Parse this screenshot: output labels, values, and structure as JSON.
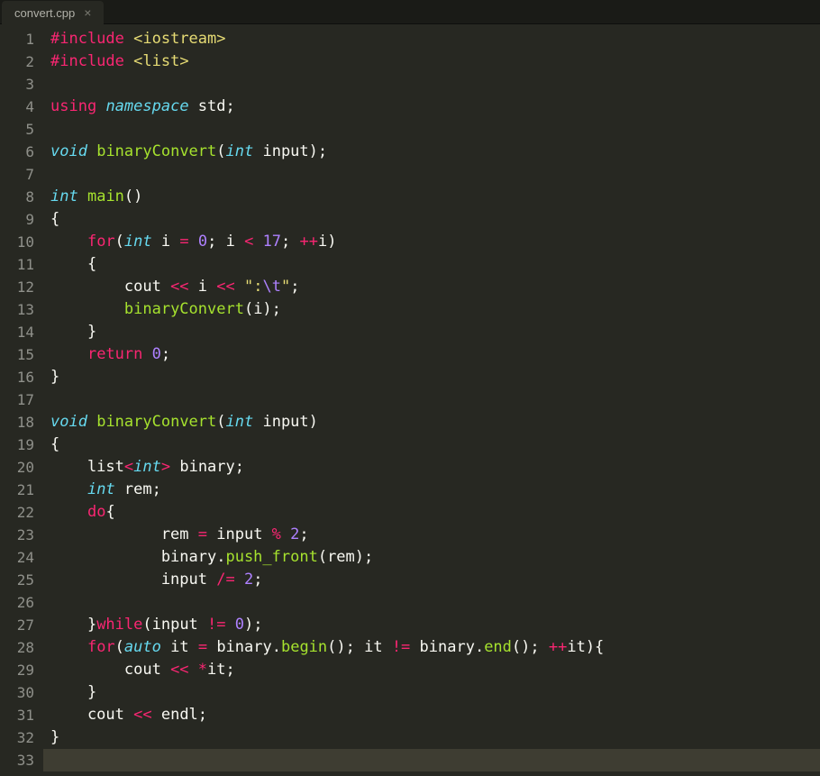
{
  "tab": {
    "title": "convert.cpp",
    "close_glyph": "×"
  },
  "gutter": {
    "start": 1,
    "end": 33
  },
  "colors": {
    "background": "#272822",
    "gutter_text": "#8f908a",
    "keyword_red": "#f92672",
    "type_blue": "#66d9ef",
    "func_green": "#a6e22e",
    "string_yellow": "#e6db74",
    "number_purple": "#ae81ff",
    "default_white": "#f8f8f2",
    "current_line_bg": "#3e3d32"
  },
  "current_line": 33,
  "code_lines": [
    [
      [
        "k-red",
        "#include"
      ],
      [
        "k-white",
        " "
      ],
      [
        "k-yellow",
        "<iostream>"
      ]
    ],
    [
      [
        "k-red",
        "#include"
      ],
      [
        "k-white",
        " "
      ],
      [
        "k-yellow",
        "<list>"
      ]
    ],
    [],
    [
      [
        "k-red",
        "using"
      ],
      [
        "k-white",
        " "
      ],
      [
        "k-blue",
        "namespace"
      ],
      [
        "k-white",
        " std;"
      ]
    ],
    [],
    [
      [
        "k-blue",
        "void"
      ],
      [
        "k-white",
        " "
      ],
      [
        "k-green",
        "binaryConvert"
      ],
      [
        "k-white",
        "("
      ],
      [
        "k-blue",
        "int"
      ],
      [
        "k-white",
        " input);"
      ]
    ],
    [],
    [
      [
        "k-blue",
        "int"
      ],
      [
        "k-white",
        " "
      ],
      [
        "k-green",
        "main"
      ],
      [
        "k-white",
        "()"
      ]
    ],
    [
      [
        "k-white",
        "{"
      ]
    ],
    [
      [
        "k-white",
        "    "
      ],
      [
        "k-red",
        "for"
      ],
      [
        "k-white",
        "("
      ],
      [
        "k-blue",
        "int"
      ],
      [
        "k-white",
        " i "
      ],
      [
        "k-red",
        "="
      ],
      [
        "k-white",
        " "
      ],
      [
        "k-purple",
        "0"
      ],
      [
        "k-white",
        "; i "
      ],
      [
        "k-red",
        "<"
      ],
      [
        "k-white",
        " "
      ],
      [
        "k-purple",
        "17"
      ],
      [
        "k-white",
        "; "
      ],
      [
        "k-red",
        "++"
      ],
      [
        "k-white",
        "i)"
      ]
    ],
    [
      [
        "k-white",
        "    {"
      ]
    ],
    [
      [
        "k-white",
        "        cout "
      ],
      [
        "k-red",
        "<<"
      ],
      [
        "k-white",
        " i "
      ],
      [
        "k-red",
        "<<"
      ],
      [
        "k-white",
        " "
      ],
      [
        "k-yellow",
        "\":"
      ],
      [
        "k-purple",
        "\\t"
      ],
      [
        "k-yellow",
        "\""
      ],
      [
        "k-white",
        ";"
      ]
    ],
    [
      [
        "k-white",
        "        "
      ],
      [
        "k-green",
        "binaryConvert"
      ],
      [
        "k-white",
        "(i);"
      ]
    ],
    [
      [
        "k-white",
        "    }"
      ]
    ],
    [
      [
        "k-white",
        "    "
      ],
      [
        "k-red",
        "return"
      ],
      [
        "k-white",
        " "
      ],
      [
        "k-purple",
        "0"
      ],
      [
        "k-white",
        ";"
      ]
    ],
    [
      [
        "k-white",
        "}"
      ]
    ],
    [],
    [
      [
        "k-blue",
        "void"
      ],
      [
        "k-white",
        " "
      ],
      [
        "k-green",
        "binaryConvert"
      ],
      [
        "k-white",
        "("
      ],
      [
        "k-blue",
        "int"
      ],
      [
        "k-white",
        " input)"
      ]
    ],
    [
      [
        "k-white",
        "{"
      ]
    ],
    [
      [
        "k-white",
        "    list"
      ],
      [
        "k-red",
        "<"
      ],
      [
        "k-blue",
        "int"
      ],
      [
        "k-red",
        ">"
      ],
      [
        "k-white",
        " binary;"
      ]
    ],
    [
      [
        "k-white",
        "    "
      ],
      [
        "k-blue",
        "int"
      ],
      [
        "k-white",
        " rem;"
      ]
    ],
    [
      [
        "k-white",
        "    "
      ],
      [
        "k-red",
        "do"
      ],
      [
        "k-white",
        "{"
      ]
    ],
    [
      [
        "k-white",
        "            rem "
      ],
      [
        "k-red",
        "="
      ],
      [
        "k-white",
        " input "
      ],
      [
        "k-red",
        "%"
      ],
      [
        "k-white",
        " "
      ],
      [
        "k-purple",
        "2"
      ],
      [
        "k-white",
        ";"
      ]
    ],
    [
      [
        "k-white",
        "            binary."
      ],
      [
        "k-green",
        "push_front"
      ],
      [
        "k-white",
        "(rem);"
      ]
    ],
    [
      [
        "k-white",
        "            input "
      ],
      [
        "k-red",
        "/="
      ],
      [
        "k-white",
        " "
      ],
      [
        "k-purple",
        "2"
      ],
      [
        "k-white",
        ";"
      ]
    ],
    [],
    [
      [
        "k-white",
        "    }"
      ],
      [
        "k-red",
        "while"
      ],
      [
        "k-white",
        "(input "
      ],
      [
        "k-red",
        "!="
      ],
      [
        "k-white",
        " "
      ],
      [
        "k-purple",
        "0"
      ],
      [
        "k-white",
        ");"
      ]
    ],
    [
      [
        "k-white",
        "    "
      ],
      [
        "k-red",
        "for"
      ],
      [
        "k-white",
        "("
      ],
      [
        "k-blue",
        "auto"
      ],
      [
        "k-white",
        " it "
      ],
      [
        "k-red",
        "="
      ],
      [
        "k-white",
        " binary."
      ],
      [
        "k-green",
        "begin"
      ],
      [
        "k-white",
        "(); it "
      ],
      [
        "k-red",
        "!="
      ],
      [
        "k-white",
        " binary."
      ],
      [
        "k-green",
        "end"
      ],
      [
        "k-white",
        "(); "
      ],
      [
        "k-red",
        "++"
      ],
      [
        "k-white",
        "it){"
      ]
    ],
    [
      [
        "k-white",
        "        cout "
      ],
      [
        "k-red",
        "<<"
      ],
      [
        "k-white",
        " "
      ],
      [
        "k-red",
        "*"
      ],
      [
        "k-white",
        "it;"
      ]
    ],
    [
      [
        "k-white",
        "    }"
      ]
    ],
    [
      [
        "k-white",
        "    cout "
      ],
      [
        "k-red",
        "<<"
      ],
      [
        "k-white",
        " endl;"
      ]
    ],
    [
      [
        "k-white",
        "}"
      ]
    ],
    []
  ]
}
